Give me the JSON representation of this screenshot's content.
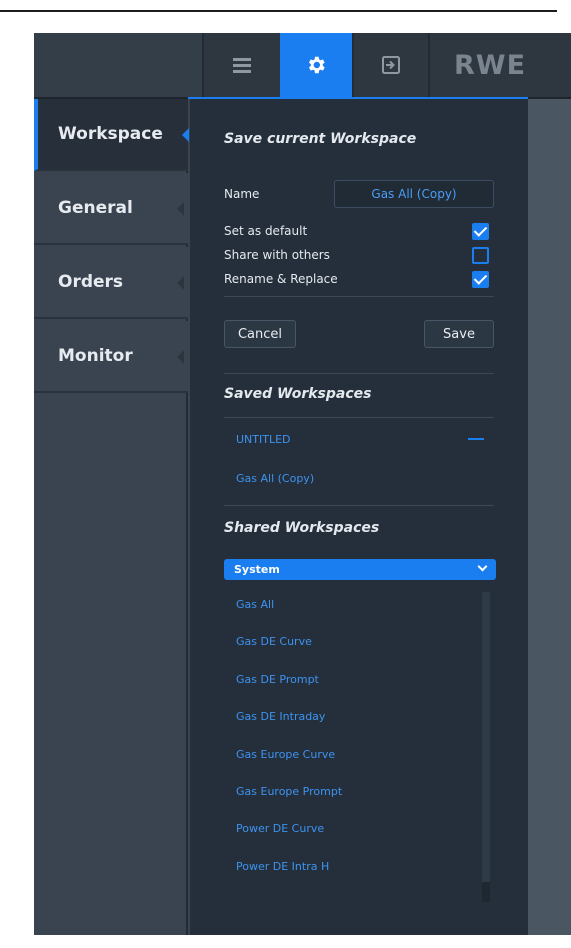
{
  "toolbar": {
    "buttons": [
      {
        "icon": "hamburger-menu-icon",
        "active": false
      },
      {
        "icon": "gear-icon",
        "active": true
      },
      {
        "icon": "export-icon",
        "active": false
      }
    ],
    "logo": "RWE",
    "accent_color": "#1a7ef0"
  },
  "sidebar": {
    "tabs": [
      {
        "label": "Workspace",
        "active": true
      },
      {
        "label": "General",
        "active": false
      },
      {
        "label": "Orders",
        "active": false
      },
      {
        "label": "Monitor",
        "active": false
      }
    ]
  },
  "save_section": {
    "title": "Save current Workspace",
    "name_label": "Name",
    "name_value": "Gas All (Copy)",
    "options": [
      {
        "label": "Set as default",
        "checked": true
      },
      {
        "label": "Share with others",
        "checked": false
      },
      {
        "label": "Rename & Replace",
        "checked": true
      }
    ],
    "cancel_label": "Cancel",
    "save_label": "Save"
  },
  "saved_section": {
    "title": "Saved Workspaces",
    "items": [
      "UNTITLED",
      "Gas All (Copy)"
    ]
  },
  "shared_section": {
    "title": "Shared Workspaces",
    "selected": "System",
    "items": [
      "Gas All",
      "Gas DE Curve",
      "Gas DE Prompt",
      "Gas DE Intraday",
      "Gas Europe Curve",
      "Gas Europe Prompt",
      "Power DE Curve",
      "Power DE Intra H"
    ]
  }
}
